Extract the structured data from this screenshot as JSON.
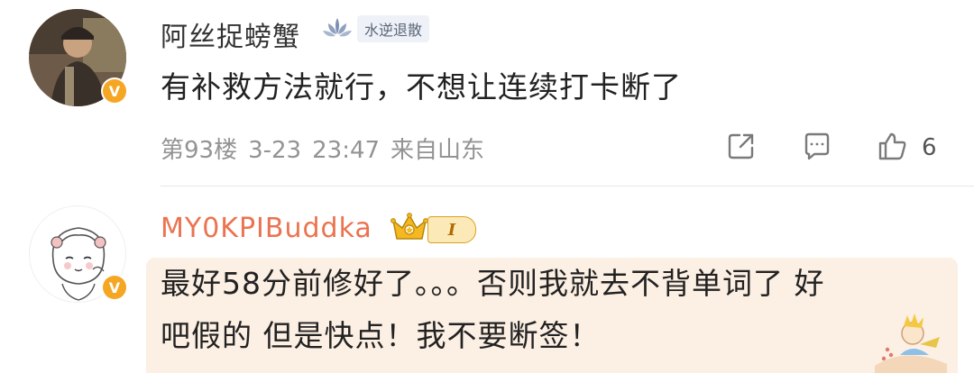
{
  "comments": [
    {
      "username": "阿丝捉螃蟹",
      "badge": "水逆退散",
      "text": "有补救方法就行，不想让连续打卡断了",
      "floor": "第93楼",
      "date": "3-23",
      "time": "23:47",
      "source": "来自山东",
      "likes": "6",
      "verified_mark": "V"
    },
    {
      "username": "MY0KPIBuddka",
      "level": "I",
      "text_line1": "最好58分前修好了。。。否则我就去不背单词了 好",
      "text_line2": "吧假的 但是快点！我不要断签！",
      "verified_mark": "V"
    }
  ],
  "colors": {
    "accent_username": "#eb7350",
    "verified": "#f5a623",
    "meta": "#939393",
    "highlight_bg": "#fcefe3"
  },
  "icons": [
    "share-icon",
    "comment-icon",
    "like-icon",
    "lotus-icon",
    "crown-icon"
  ]
}
